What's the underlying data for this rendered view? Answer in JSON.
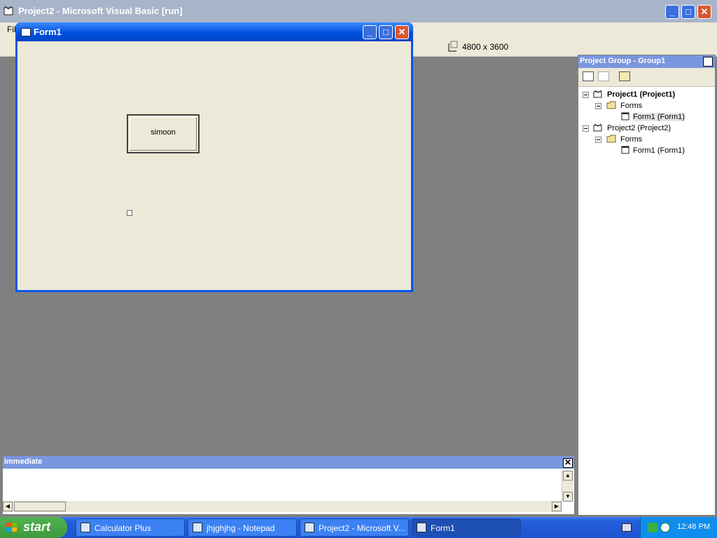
{
  "app": {
    "title": "Project2 - Microsoft Visual Basic [run]",
    "menu_first": "File",
    "size_indicator": "4800 x 3600"
  },
  "form1": {
    "title": "Form1",
    "button_caption": "simoon"
  },
  "project_group": {
    "title": "Project Group - Group1",
    "tree": [
      {
        "label": "Project1 (Project1)",
        "bold": true
      },
      {
        "label": "Forms"
      },
      {
        "label": "Form1 (Form1)",
        "selected": true
      },
      {
        "label": "Project2 (Project2)"
      },
      {
        "label": "Forms"
      },
      {
        "label": "Form1 (Form1)"
      }
    ]
  },
  "immediate": {
    "title": "Immediate"
  },
  "taskbar": {
    "start_label": "start",
    "tasks": [
      {
        "label": "Calculator Plus"
      },
      {
        "label": "jhjghjhg - Notepad"
      },
      {
        "label": "Project2 - Microsoft V..."
      },
      {
        "label": "Form1"
      }
    ],
    "clock": "12:48 PM"
  },
  "colors": {
    "xp_blue": "#0058ee",
    "taskbar_blue": "#245edb",
    "start_green": "#3c9a3c",
    "pane_title": "#7a96df"
  }
}
